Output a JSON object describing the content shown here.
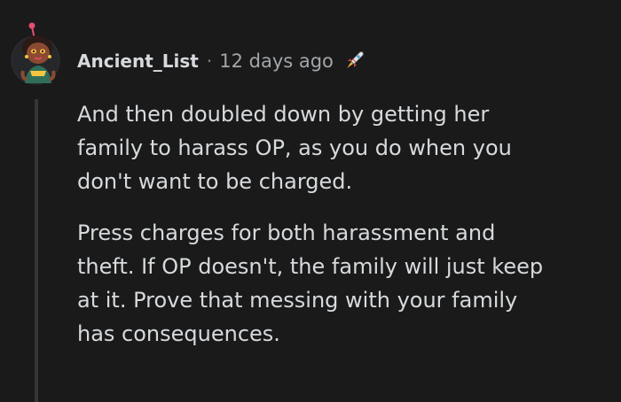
{
  "comment": {
    "author": "Ancient_List",
    "separator": "·",
    "time_ago": "12 days ago",
    "award_icon": "rocket-like-award-icon",
    "paragraphs": [
      "And then doubled down by getting her\nfamily to harass OP, as you do when you\ndon't want to be charged.",
      "Press charges for both harassment and\ntheft. If OP doesn't, the family will just keep\nat it. Prove that messing with your family\nhas consequences."
    ]
  },
  "colors": {
    "background": "#1a1a1b",
    "text": "#d7dadc",
    "meta": "#a3a6a8",
    "thread_line": "#343536"
  }
}
